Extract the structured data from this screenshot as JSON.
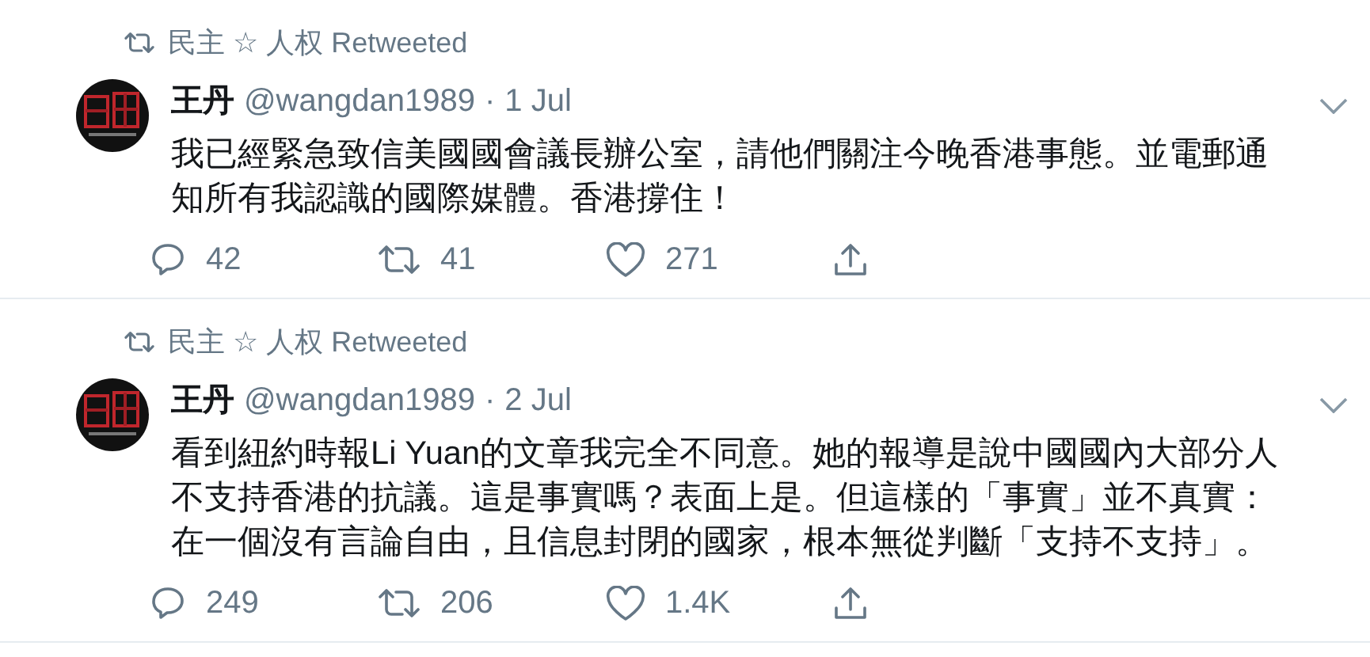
{
  "tweets": [
    {
      "retweeted_by": "民主 ☆ 人权",
      "retweet_label": "Retweeted",
      "name": "王丹",
      "handle": "@wangdan1989",
      "separator": "·",
      "date": "1 Jul",
      "text_lines": [
        "我已經緊急致信美國國會議長辦公室，請他們關注今晚香港事態。並電郵通",
        "知所有我認識的國際媒體。香港撐住！"
      ],
      "actions": [
        {
          "kind": "reply",
          "count": "42"
        },
        {
          "kind": "retweet",
          "count": "41"
        },
        {
          "kind": "like",
          "count": "271"
        },
        {
          "kind": "share"
        }
      ]
    },
    {
      "retweeted_by": "民主 ☆ 人权",
      "retweet_label": "Retweeted",
      "name": "王丹",
      "handle": "@wangdan1989",
      "separator": "·",
      "date": "2 Jul",
      "text_lines": [
        "看到紐約時報Li Yuan的文章我完全不同意。她的報導是說中國國內大部分人",
        "不支持香港的抗議。這是事實嗎？表面上是。但這樣的「事實」並不真實：",
        "在一個沒有言論自由，且信息封閉的國家，根本無從判斷「支持不支持」。"
      ],
      "actions": [
        {
          "kind": "reply",
          "count": "249"
        },
        {
          "kind": "retweet",
          "count": "206"
        },
        {
          "kind": "like",
          "count": "1.4K"
        },
        {
          "kind": "share"
        }
      ]
    }
  ]
}
